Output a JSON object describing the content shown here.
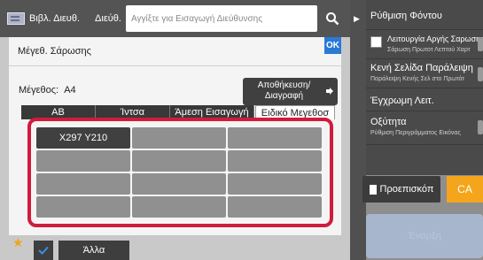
{
  "topbar": {
    "address_book_label": "Βιβλ. Διευθ.",
    "destination_label": "Διεύθ.",
    "search_placeholder": "Αγγίξτε για Εισαγωγή Διεύθυνσης"
  },
  "dialog": {
    "title": "Μέγεθ. Σάρωσης",
    "ok_label": "OK",
    "size_label": "Μέγεθος:",
    "size_value": "A4",
    "store_button_line1": "Αποθήκευση/",
    "store_button_line2": "Διαγραφή",
    "tabs": [
      {
        "label": "AB"
      },
      {
        "label": "Ίντσα"
      },
      {
        "label": "Άμεση Εισαγωγή"
      },
      {
        "label": "Ειδικό Μεγεθοσ"
      }
    ],
    "active_tab": "Ειδικό Μεγεθοσ",
    "custom_sizes": [
      "X297 Y210",
      "",
      "",
      "",
      "",
      "",
      "",
      "",
      "",
      "",
      "",
      ""
    ]
  },
  "bottombar": {
    "other_label": "Άλλα"
  },
  "sidebar": {
    "items": [
      {
        "title": "Ρύθμιση Φόντου",
        "subtitle": ""
      },
      {
        "title": "Λειτουργία Αργής Σαρωσης",
        "subtitle": "Σάρωση Πρωτοτ Λεπτού Χαρτ"
      },
      {
        "title": "Κενή Σελίδα Παράλειψη",
        "subtitle": "Παράλειψη Κενής Σελ στο Πρωτότ"
      },
      {
        "title": "Έγχρωμη Λειτ.",
        "subtitle": ""
      },
      {
        "title": "Οξύτητα",
        "subtitle": "Ρύθμιση Περιγράμματος Εικόνας"
      }
    ],
    "preview_label": "Προεπισκόπ",
    "ca_label": "CA",
    "start_label": "Έναρξη"
  },
  "colors": {
    "highlight_frame": "#d11b3d",
    "ok_blue": "#2a7ad5",
    "ca_orange": "#f4a51b"
  }
}
